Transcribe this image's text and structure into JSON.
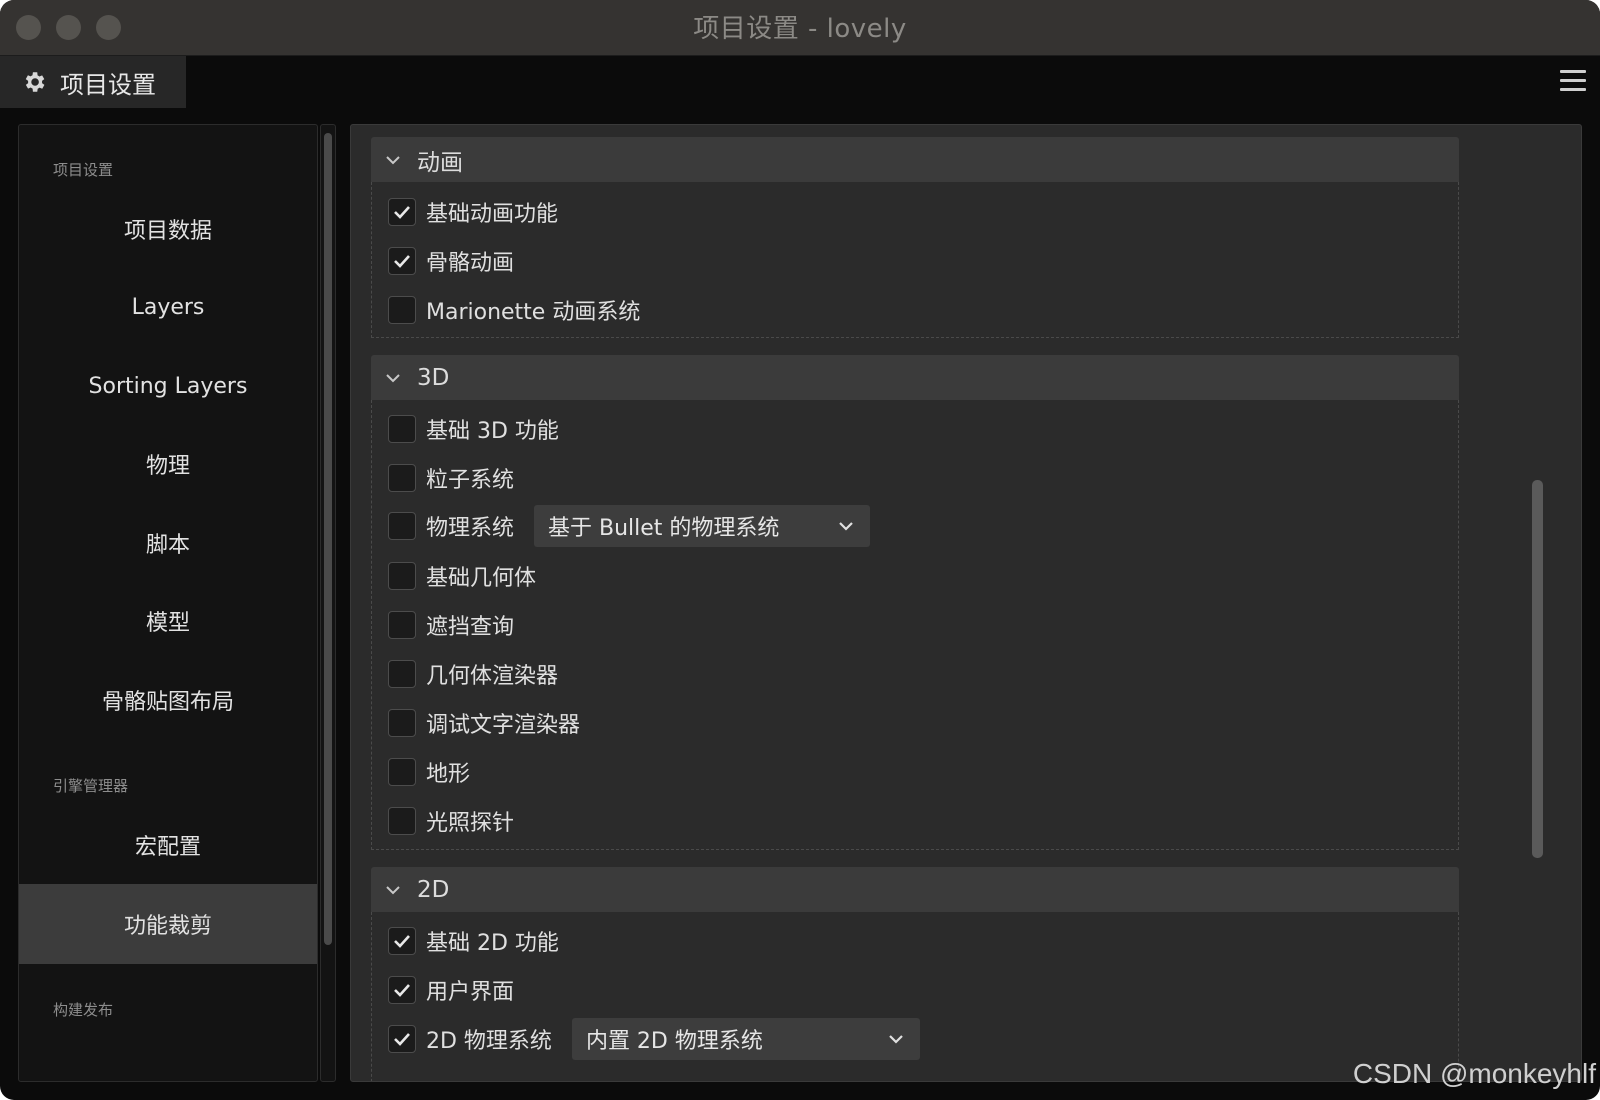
{
  "window": {
    "title": "项目设置 - lovely"
  },
  "tab": {
    "label": "项目设置",
    "icon": "gear-icon"
  },
  "sidebar": {
    "groups": [
      {
        "label": "项目设置"
      },
      {
        "label": "引擎管理器"
      },
      {
        "label": "构建发布"
      }
    ],
    "items": [
      {
        "label": "项目数据"
      },
      {
        "label": "Layers"
      },
      {
        "label": "Sorting Layers"
      },
      {
        "label": "物理"
      },
      {
        "label": "脚本"
      },
      {
        "label": "模型"
      },
      {
        "label": "骨骼贴图布局"
      },
      {
        "label": "宏配置"
      },
      {
        "label": "功能裁剪",
        "active": true
      }
    ]
  },
  "sections": [
    {
      "title": "动画",
      "rows": [
        {
          "label": "基础动画功能",
          "checked": true
        },
        {
          "label": "骨骼动画",
          "checked": true
        },
        {
          "label": "Marionette 动画系统",
          "checked": false
        }
      ]
    },
    {
      "title": "3D",
      "rows": [
        {
          "label": "基础 3D 功能",
          "checked": false
        },
        {
          "label": "粒子系统",
          "checked": false
        },
        {
          "label": "物理系统",
          "checked": false,
          "dropdown": "基于 Bullet 的物理系统"
        },
        {
          "label": "基础几何体",
          "checked": false
        },
        {
          "label": "遮挡查询",
          "checked": false
        },
        {
          "label": "几何体渲染器",
          "checked": false
        },
        {
          "label": "调试文字渲染器",
          "checked": false
        },
        {
          "label": "地形",
          "checked": false
        },
        {
          "label": "光照探针",
          "checked": false
        }
      ]
    },
    {
      "title": "2D",
      "rows": [
        {
          "label": "基础 2D 功能",
          "checked": true
        },
        {
          "label": "用户界面",
          "checked": true
        },
        {
          "label": "2D 物理系统",
          "checked": true,
          "dropdown": "内置 2D 物理系统"
        }
      ]
    }
  ],
  "watermark": "CSDN @monkeyhlf",
  "colors": {
    "window_bg": "#0b0b0b",
    "panel_bg": "#2b2b2b",
    "sidebar_bg": "#131313",
    "active_item": "#3c3c3c"
  }
}
